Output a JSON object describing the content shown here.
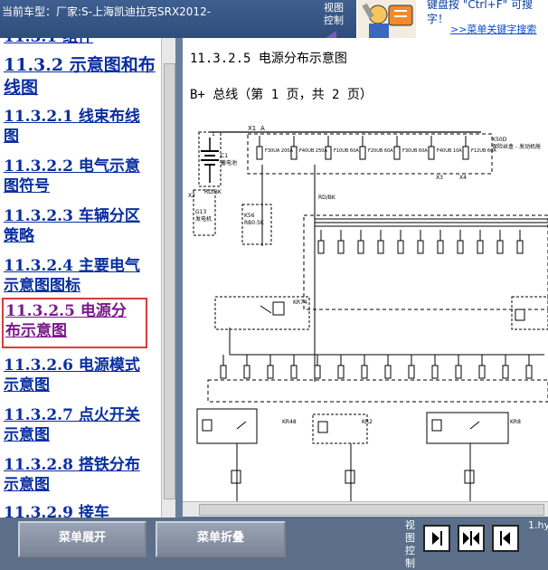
{
  "header": {
    "vehicle_label": "当前车型：厂家:S-上海凯迪拉克SRX2012-",
    "view_control": "视图控制",
    "ad_text_line1": "键盘按 \"Ctrl+F\" 可搜",
    "ad_text_line2": "字！",
    "ad_link": ">>菜单关键字搜索"
  },
  "toc": {
    "cut_item": "11.3.1 组件",
    "section": "11.3.2 示意图和布线图",
    "items": [
      {
        "label": "11.3.2.1 线束布线图"
      },
      {
        "label": "11.3.2.2 电气示意图符号"
      },
      {
        "label": "11.3.2.3 车辆分区策略"
      },
      {
        "label": "11.3.2.4 主要电气示意图图标"
      },
      {
        "label": "11.3.2.5 电源分布示意图"
      },
      {
        "label": "11.3.2.6 电源模式示意图"
      },
      {
        "label": "11.3.2.7 点火开关示意图"
      },
      {
        "label": "11.3.2.8 搭铁分布示意图"
      },
      {
        "label": "11.3.2.9 接车"
      }
    ]
  },
  "content": {
    "title": "11.3.2.5 电源分布示意图",
    "subtitle": "B+ 总线（第 1 页，共 2 页）",
    "diagram": {
      "battery": {
        "num": "1",
        "name": "C1",
        "label": "蓄电池"
      },
      "relay_texts": [
        "KR74",
        "KR48",
        "KR2",
        "KR8"
      ],
      "top_fuses": [
        "F30UA 200A",
        "F40UB 250A",
        "F10UB 60A",
        "F20UB 60A",
        "F30UB 60A",
        "F40UB 10A",
        "F12UB 60A"
      ],
      "fuse_label": "保险丝",
      "x50d": "X50D",
      "x50d_label": "保险丝盒 - 发动机舱",
      "g13": "G13",
      "g13_label": "发电机",
      "k56": "K56",
      "k56_label": "RB0.5K",
      "rd_bk": "RD/BK",
      "conn_x1": "X1",
      "conn_x2": "X2",
      "conn_x3": "X3",
      "conn_x4": "X4",
      "conn_a": "A"
    }
  },
  "footer": {
    "expand_label": "菜单展开",
    "collapse_label": "菜单折叠",
    "view_control": "视图控制",
    "page_index": "1.hy"
  }
}
